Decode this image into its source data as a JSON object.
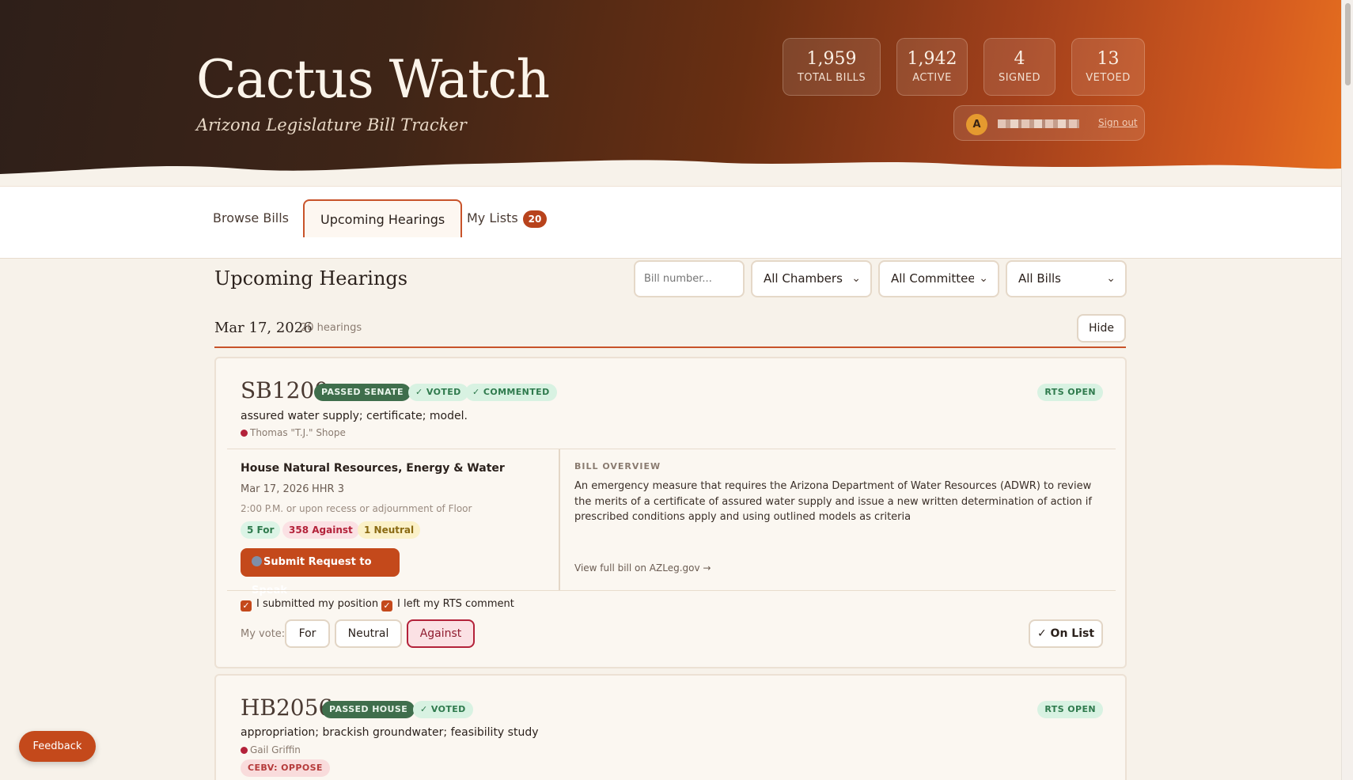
{
  "header": {
    "title": "Cactus Watch",
    "subtitle": "Arizona Legislature Bill Tracker",
    "stats": [
      {
        "value": "1,959",
        "label": "TOTAL BILLS"
      },
      {
        "value": "1,942",
        "label": "ACTIVE"
      },
      {
        "value": "4",
        "label": "SIGNED"
      },
      {
        "value": "13",
        "label": "VETOED"
      }
    ],
    "user": {
      "avatar_initial": "A",
      "sign_out": "Sign out"
    }
  },
  "tabs": [
    {
      "label": "Browse Bills"
    },
    {
      "label": "Upcoming Hearings"
    },
    {
      "label": "My Lists",
      "badge": "20"
    }
  ],
  "toolbar": {
    "title": "Upcoming Hearings",
    "bill_placeholder": "Bill number...",
    "chamber": "All Chambers",
    "committee": "All Committees",
    "bills": "All Bills"
  },
  "date_group": {
    "date": "Mar 17, 2026",
    "count": "20 hearings",
    "hide": "Hide"
  },
  "cards": [
    {
      "bill": "SB1200",
      "status": "PASSED SENATE",
      "tags": [
        "✓ VOTED",
        "✓ COMMENTED"
      ],
      "rts": "RTS OPEN",
      "short_title": "assured water supply; certificate; model.",
      "sponsor": "Thomas \"T.J.\" Shope",
      "committee": "House Natural Resources, Energy & Water",
      "date": "Mar 17, 2026",
      "room": "HHR 3",
      "time": "2:00 P.M. or upon recess or adjournment of Floor",
      "positions": {
        "for": "5 For",
        "against": "358 Against",
        "neutral": "1 Neutral"
      },
      "rts_button": "Submit Request to Speak",
      "overview_heading": "BILL OVERVIEW",
      "overview": "An emergency measure that requires the Arizona Department of Water Resources (ADWR) to review the merits of a certificate of assured water supply and issue a new written determination of action if prescribed conditions apply and using outlined models as criteria",
      "overview_link": "View full bill on AZLeg.gov →",
      "check_position": "I submitted my position",
      "check_comment": "I left my RTS comment",
      "vote_label": "My vote:",
      "votes": [
        "For",
        "Neutral",
        "Against"
      ],
      "selected_vote": "Against",
      "on_list": "✓ On List"
    },
    {
      "bill": "HB2056",
      "status": "PASSED HOUSE",
      "tags": [
        "✓ VOTED"
      ],
      "rts": "RTS OPEN",
      "short_title": "appropriation; brackish groundwater; feasibility study",
      "sponsor": "Gail Griffin",
      "cebv": "CEBV: OPPOSE"
    }
  ],
  "feedback": "Feedback",
  "colors": {
    "accent": "#c4491b",
    "status_green": "#3f6e4c",
    "against_red": "#b3223a"
  }
}
